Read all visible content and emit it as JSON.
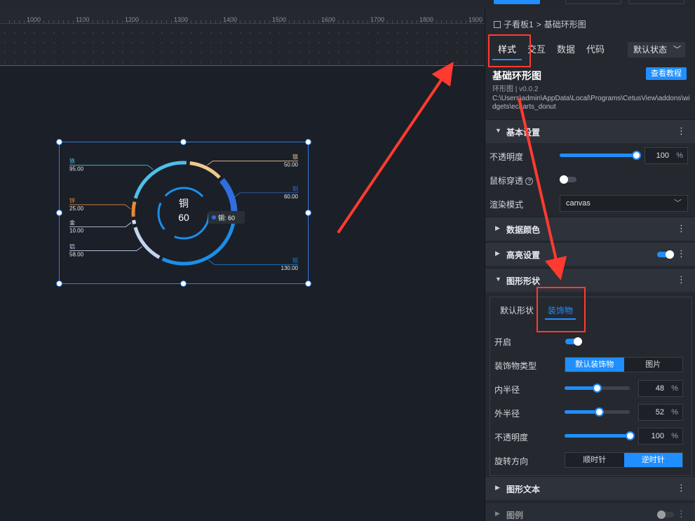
{
  "ruler": {
    "ticks": [
      "1000",
      "1100",
      "1200",
      "1300",
      "1400",
      "1500",
      "1600",
      "1700",
      "1800",
      "1900"
    ]
  },
  "panel": {
    "breadcrumb": {
      "parent": "子看板1",
      "sep": ">",
      "current": "基础环形图"
    },
    "tabs": [
      {
        "label": "样式",
        "active": true
      },
      {
        "label": "交互",
        "active": false
      },
      {
        "label": "数据",
        "active": false
      },
      {
        "label": "代码",
        "active": false
      }
    ],
    "state_select": "默认状态",
    "widget_title": "基础环形图",
    "tutorial_button": "查看教程",
    "widget_subtitle": "环形图 | v0.0.2",
    "widget_path": "C:\\Users\\admin\\AppData\\Local\\Programs\\CetusView\\addons\\widgets\\echarts_donut",
    "basic_section": {
      "label": "基本设置",
      "opacity_label": "不透明度",
      "opacity_value": "100",
      "opacity_unit": "%",
      "mouse_passthrough_label": "鼠标穿透",
      "render_mode_label": "渲染模式",
      "render_mode_value": "canvas"
    },
    "data_color_section": "数据颜色",
    "highlight_section": "高亮设置",
    "shape_section": {
      "label": "图形形状",
      "subtabs": [
        "默认形状",
        "装饰物"
      ],
      "enable_label": "开启",
      "decor_type_label": "装饰物类型",
      "decor_type_options": [
        "默认装饰物",
        "图片"
      ],
      "inner_radius_label": "内半径",
      "inner_radius_value": "48",
      "inner_radius_unit": "%",
      "outer_radius_label": "外半径",
      "outer_radius_value": "52",
      "outer_radius_unit": "%",
      "opacity_label": "不透明度",
      "opacity_value": "100",
      "opacity_unit": "%",
      "rotation_label": "旋转方向",
      "rotation_options": [
        "顺时针",
        "逆时针"
      ]
    },
    "shape_text_section": "图形文本",
    "legend_section": "图例"
  },
  "chart_data": {
    "type": "pie",
    "center_label": "铜",
    "center_value": "60",
    "tooltip": "铜: 60",
    "slices": [
      {
        "name": "银",
        "value": 50.0,
        "label": "50.00",
        "color": "#f0c98d"
      },
      {
        "name": "铜",
        "value": 60.0,
        "label": "60.00",
        "color": "#2f6fe0"
      },
      {
        "name": "铅",
        "value": 130.0,
        "label": "130.00",
        "color": "#1a8fe8"
      },
      {
        "name": "铝",
        "value": 58.0,
        "label": "58.00",
        "color": "#c4d4ef"
      },
      {
        "name": "金",
        "value": 10.0,
        "label": "10.00",
        "color": "#d8e2f2"
      },
      {
        "name": "锌",
        "value": 25.0,
        "label": "25.00",
        "color": "#e58a3c"
      },
      {
        "name": "铁",
        "value": 95.0,
        "label": "95.00",
        "color": "#4dc0e8"
      }
    ]
  }
}
